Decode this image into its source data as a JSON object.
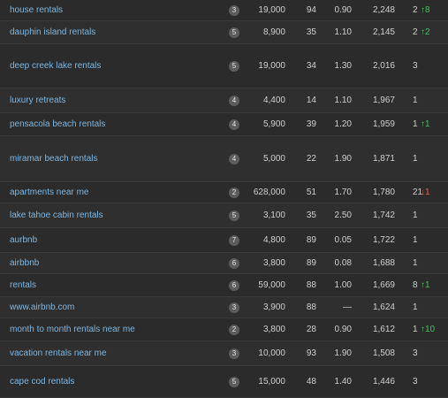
{
  "colors": {
    "keyword_link": "#7fb6e0",
    "up": "#45c160",
    "down": "#e35d4f",
    "background": "#2b2b2b"
  },
  "rows": [
    {
      "keyword": "house rentals",
      "kd": "3",
      "volume": "19,000",
      "cpc": "94",
      "competition": "0.90",
      "results": "2,248",
      "position": "2",
      "change": "↑8",
      "dir": "up"
    },
    {
      "keyword": "dauphin island rentals",
      "kd": "5",
      "volume": "8,900",
      "cpc": "35",
      "competition": "1.10",
      "results": "2,145",
      "position": "2",
      "change": "↑2",
      "dir": "up"
    },
    {
      "keyword": "deep creek lake rentals",
      "kd": "5",
      "volume": "19,000",
      "cpc": "34",
      "competition": "1.30",
      "results": "2,016",
      "position": "3",
      "change": "",
      "dir": ""
    },
    {
      "keyword": "luxury retreats",
      "kd": "4",
      "volume": "4,400",
      "cpc": "14",
      "competition": "1.10",
      "results": "1,967",
      "position": "1",
      "change": "",
      "dir": ""
    },
    {
      "keyword": "pensacola beach rentals",
      "kd": "4",
      "volume": "5,900",
      "cpc": "39",
      "competition": "1.20",
      "results": "1,959",
      "position": "1",
      "change": "↑1",
      "dir": "up"
    },
    {
      "keyword": "miramar beach rentals",
      "kd": "4",
      "volume": "5,000",
      "cpc": "22",
      "competition": "1.90",
      "results": "1,871",
      "position": "1",
      "change": "",
      "dir": ""
    },
    {
      "keyword": "apartments near me",
      "kd": "2",
      "volume": "628,000",
      "cpc": "51",
      "competition": "1.70",
      "results": "1,780",
      "position": "21",
      "change": "↓1",
      "dir": "down"
    },
    {
      "keyword": "lake tahoe cabin rentals",
      "kd": "5",
      "volume": "3,100",
      "cpc": "35",
      "competition": "2.50",
      "results": "1,742",
      "position": "1",
      "change": "",
      "dir": ""
    },
    {
      "keyword": "aurbnb",
      "kd": "7",
      "volume": "4,800",
      "cpc": "89",
      "competition": "0.05",
      "results": "1,722",
      "position": "1",
      "change": "",
      "dir": ""
    },
    {
      "keyword": "airbbnb",
      "kd": "6",
      "volume": "3,800",
      "cpc": "89",
      "competition": "0.08",
      "results": "1,688",
      "position": "1",
      "change": "",
      "dir": ""
    },
    {
      "keyword": "rentals",
      "kd": "6",
      "volume": "59,000",
      "cpc": "88",
      "competition": "1.00",
      "results": "1,669",
      "position": "8",
      "change": "↑1",
      "dir": "up"
    },
    {
      "keyword": "www.airbnb.com",
      "kd": "3",
      "volume": "3,900",
      "cpc": "88",
      "competition": "—",
      "results": "1,624",
      "position": "1",
      "change": "",
      "dir": ""
    },
    {
      "keyword": "month to month rentals near me",
      "kd": "2",
      "volume": "3,800",
      "cpc": "28",
      "competition": "0.90",
      "results": "1,612",
      "position": "1",
      "change": "↑10",
      "dir": "up"
    },
    {
      "keyword": "vacation rentals near me",
      "kd": "3",
      "volume": "10,000",
      "cpc": "93",
      "competition": "1.90",
      "results": "1,508",
      "position": "3",
      "change": "",
      "dir": ""
    },
    {
      "keyword": "cape cod rentals",
      "kd": "5",
      "volume": "15,000",
      "cpc": "48",
      "competition": "1.40",
      "results": "1,446",
      "position": "3",
      "change": "",
      "dir": ""
    }
  ]
}
